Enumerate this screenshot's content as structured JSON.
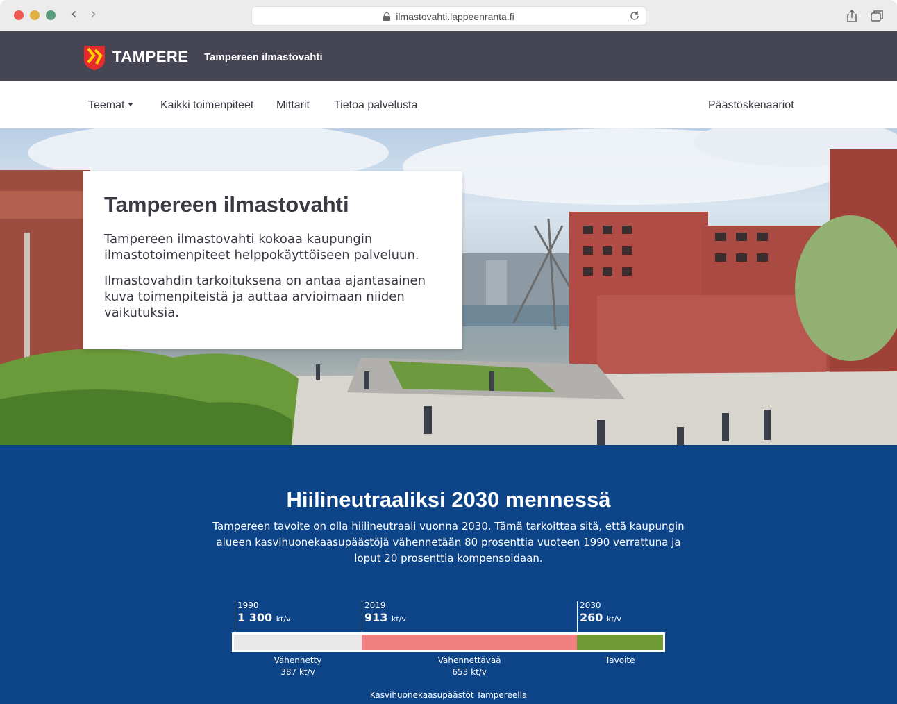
{
  "browser": {
    "url": "ilmastovahti.lappeenranta.fi",
    "traffic_lights": [
      "#ee5a52",
      "#e2b040",
      "#5a9d7d"
    ]
  },
  "header": {
    "brand": "TAMPERE",
    "site_title": "Tampereen ilmastovahti",
    "background": "#464553"
  },
  "nav": {
    "items": [
      {
        "label": "Teemat",
        "has_dropdown": true
      },
      {
        "label": "Kaikki toimenpiteet"
      },
      {
        "label": "Mittarit"
      },
      {
        "label": "Tietoa palvelusta"
      }
    ],
    "right_item": "Päästöskenaariot"
  },
  "hero": {
    "title": "Tampereen ilmastovahti",
    "paragraph1": "Tampereen ilmastovahti kokoaa kaupungin ilmastotoimenpiteet helppokäyttöiseen palveluun.",
    "paragraph2": "Ilmastovahdin tarkoituksena on antaa ajantasainen kuva toimenpiteistä ja auttaa arvioimaan niiden vaikutuksia."
  },
  "goal": {
    "title": "Hiilineutraaliksi 2030 mennessä",
    "text": "Tampereen tavoite on olla hiilineutraali vuonna 2030. Tämä tarkoittaa sitä, että kaupungin alueen kasvihuonekaasupäästöjä vähennetään 80 prosenttia vuoteen 1990 verrattuna ja loput 20 prosenttia kompensoidaan.",
    "background": "#0d4387",
    "caption": "Kasvihuonekaasupäästöt Tampereella"
  },
  "chart_data": {
    "type": "bar",
    "title": "",
    "caption": "Kasvihuonekaasupäästöt Tampereella",
    "unit": "kt/v",
    "markers": [
      {
        "year": "1990",
        "value": "1 300",
        "unit": "kt/v"
      },
      {
        "year": "2019",
        "value": "913",
        "unit": "kt/v"
      },
      {
        "year": "2030",
        "value": "260",
        "unit": "kt/v"
      }
    ],
    "segments": [
      {
        "name": "Vähennetty",
        "value": 387,
        "value_label": "387 kt/v",
        "color": "#e8e8e8"
      },
      {
        "name": "Vähennettävää",
        "value": 653,
        "value_label": "653 kt/v",
        "color": "#f08080"
      },
      {
        "name": "Tavoite",
        "value": 260,
        "value_label": "",
        "color": "#6f9a34"
      }
    ]
  }
}
